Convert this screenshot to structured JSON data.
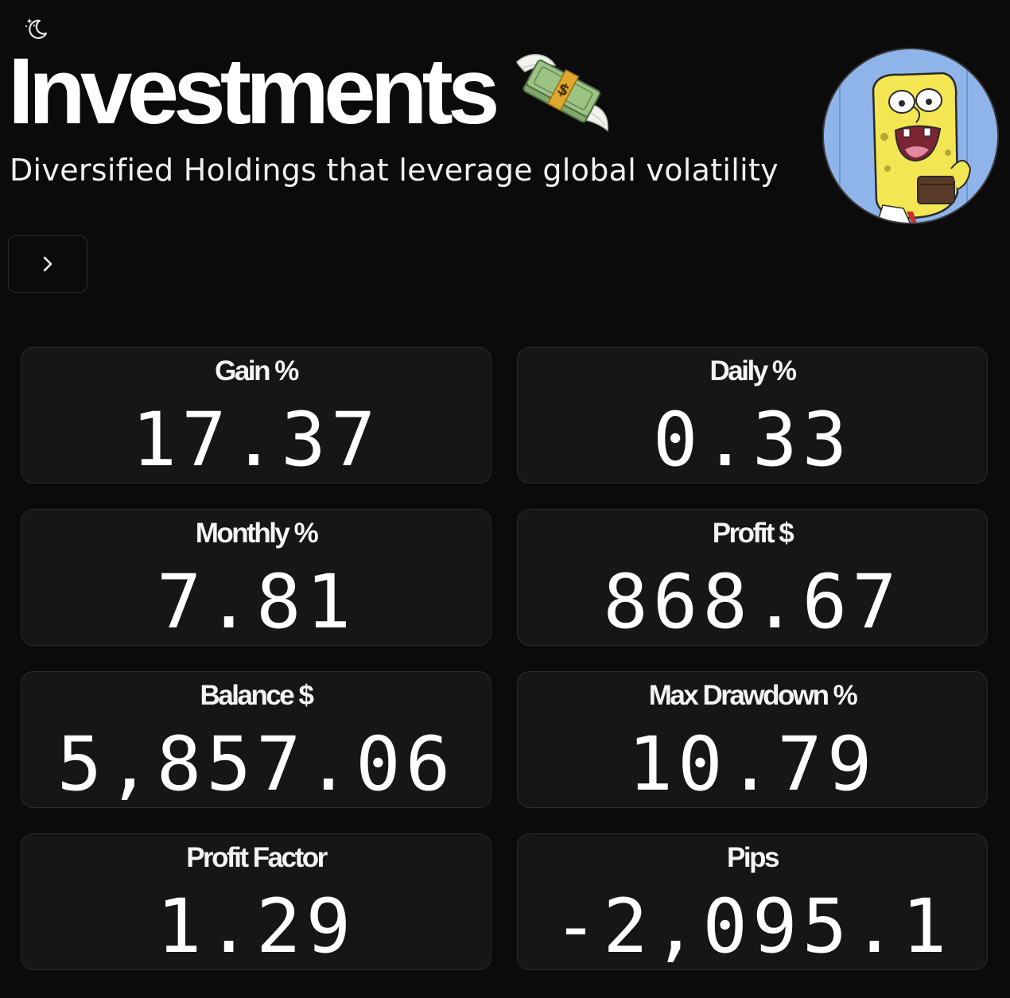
{
  "header": {
    "title": "Investments",
    "subtitle": "Diversified Holdings that leverage global volatility"
  },
  "icons": {
    "theme_toggle": "moon-stars-icon",
    "title_emoji": "money-with-wings-icon",
    "next": "chevron-right-icon",
    "avatar": "spongebob-avatar"
  },
  "colors": {
    "background": "#0b0b0c",
    "card": "#161617",
    "card_border": "#2b2b2e",
    "text": "#ffffff"
  },
  "stats": [
    {
      "label": "Gain %",
      "value": "17.37"
    },
    {
      "label": "Daily %",
      "value": "0.33"
    },
    {
      "label": "Monthly %",
      "value": "7.81"
    },
    {
      "label": "Profit $",
      "value": "868.67"
    },
    {
      "label": "Balance $",
      "value": "5,857.06"
    },
    {
      "label": "Max Drawdown %",
      "value": "10.79"
    },
    {
      "label": "Profit Factor",
      "value": "1.29"
    },
    {
      "label": "Pips",
      "value": "-2,095.1"
    }
  ]
}
